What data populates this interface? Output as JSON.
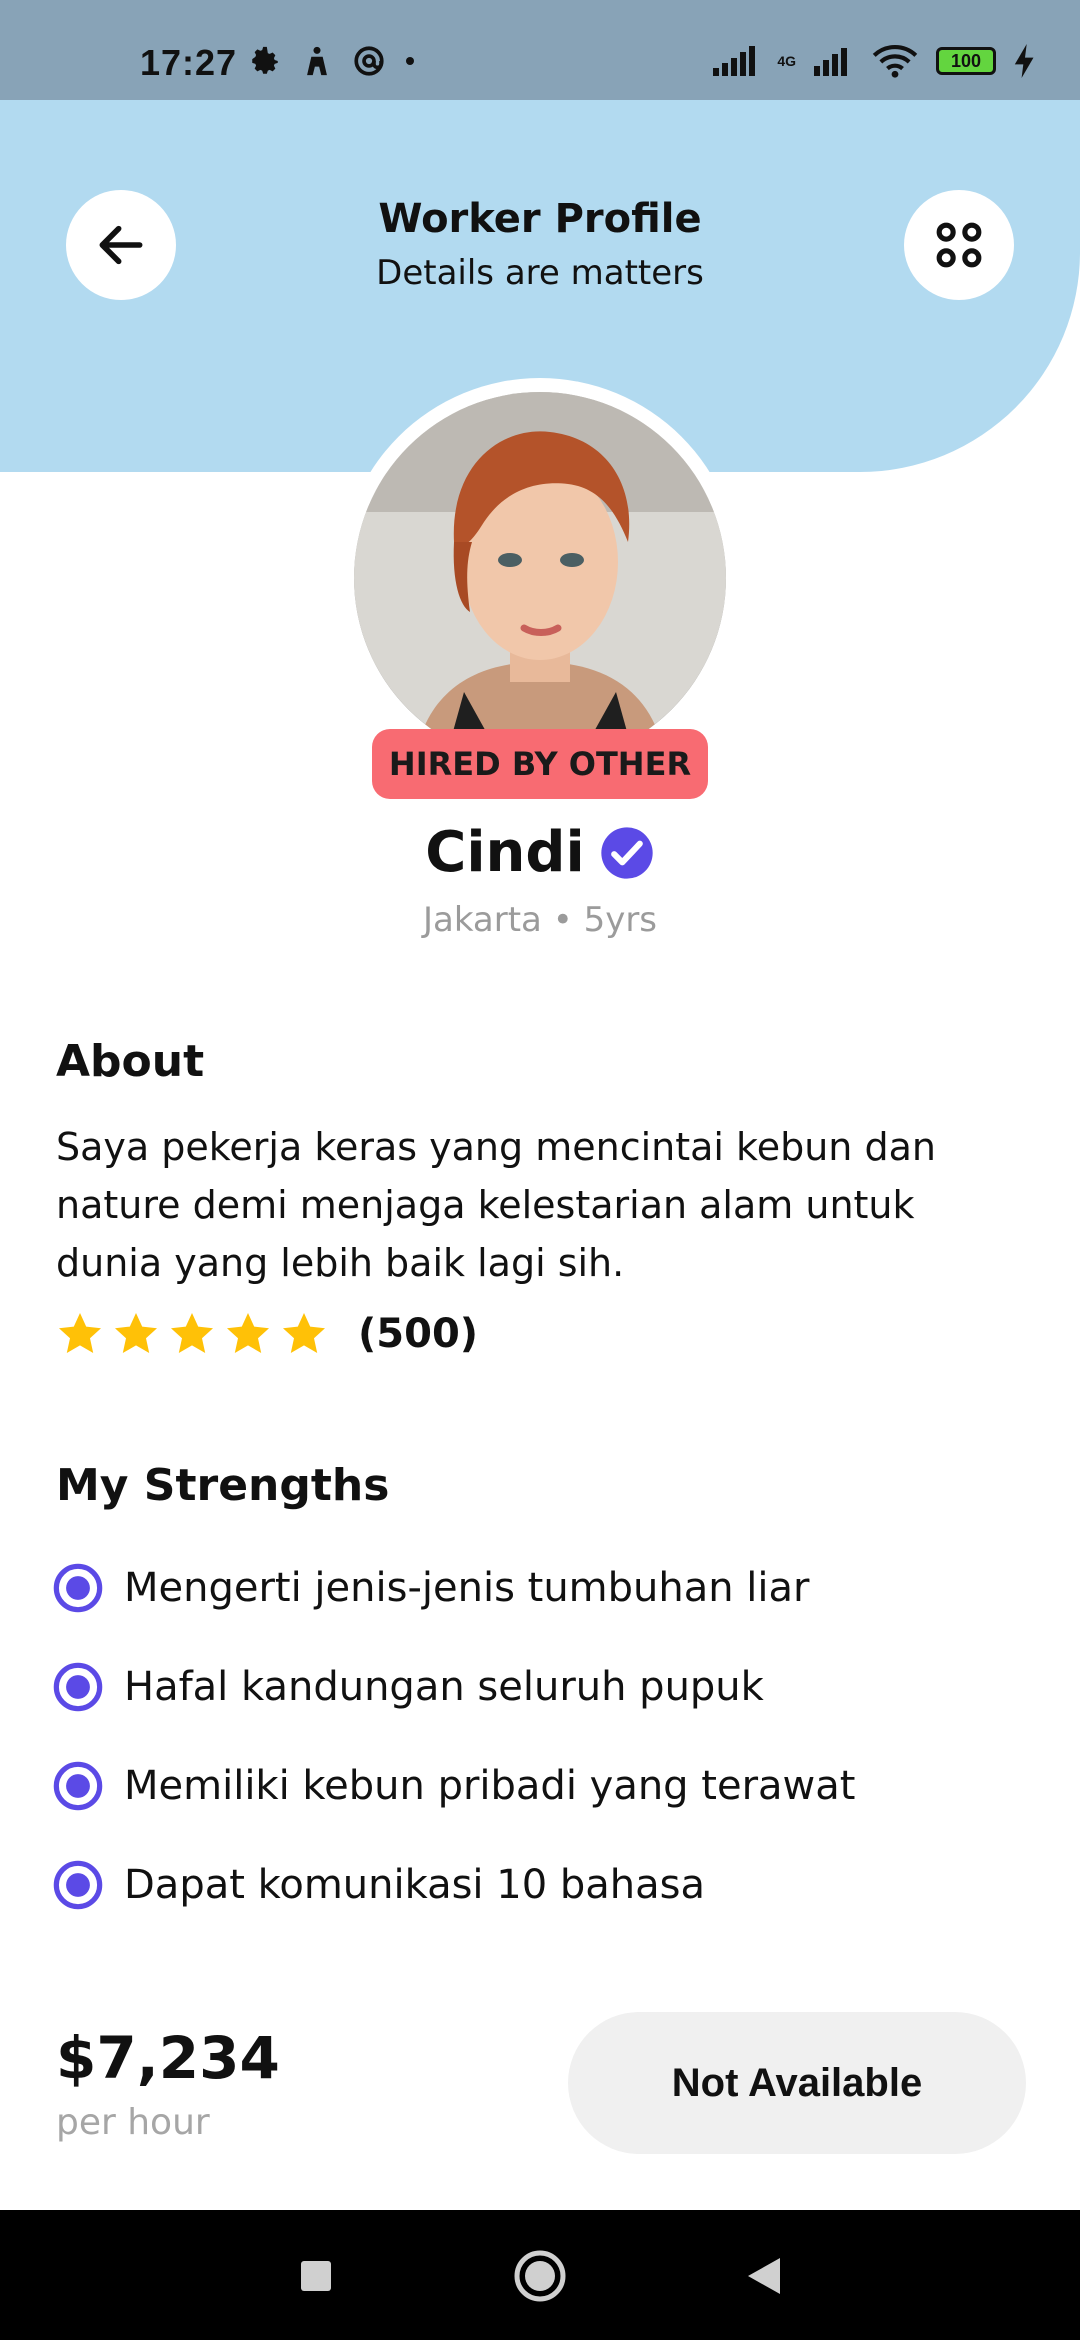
{
  "status_bar": {
    "time": "17:27",
    "network_label": "4G",
    "battery": "100"
  },
  "header": {
    "title": "Worker Profile",
    "subtitle": "Details are matters"
  },
  "profile": {
    "badge": "HIRED BY OTHER",
    "name": "Cindi",
    "location": "Jakarta",
    "separator": "•",
    "experience": "5yrs"
  },
  "about": {
    "heading": "About",
    "text": "Saya pekerja keras yang mencintai kebun dan nature demi menjaga kelestarian alam untuk dunia yang lebih baik lagi sih.",
    "stars": 5,
    "rating_count": "(500)"
  },
  "strengths": {
    "heading": "My Strengths",
    "items": [
      "Mengerti jenis-jenis tumbuhan liar",
      "Hafal kandungan seluruh pupuk",
      "Memiliki kebun pribadi yang terawat",
      "Dapat komunikasi 10 bahasa"
    ]
  },
  "pricing": {
    "price": "$7,234",
    "unit": "per hour",
    "button_label": "Not Available"
  },
  "colors": {
    "header_bg": "#b2daf0",
    "badge": "#f86b72",
    "accent": "#5b4ae6",
    "star": "#ffc107"
  },
  "icons": {
    "back": "arrow-left-icon",
    "menu": "four-dots-icon",
    "verified": "check-badge-icon",
    "strength": "radio-selected-icon"
  }
}
